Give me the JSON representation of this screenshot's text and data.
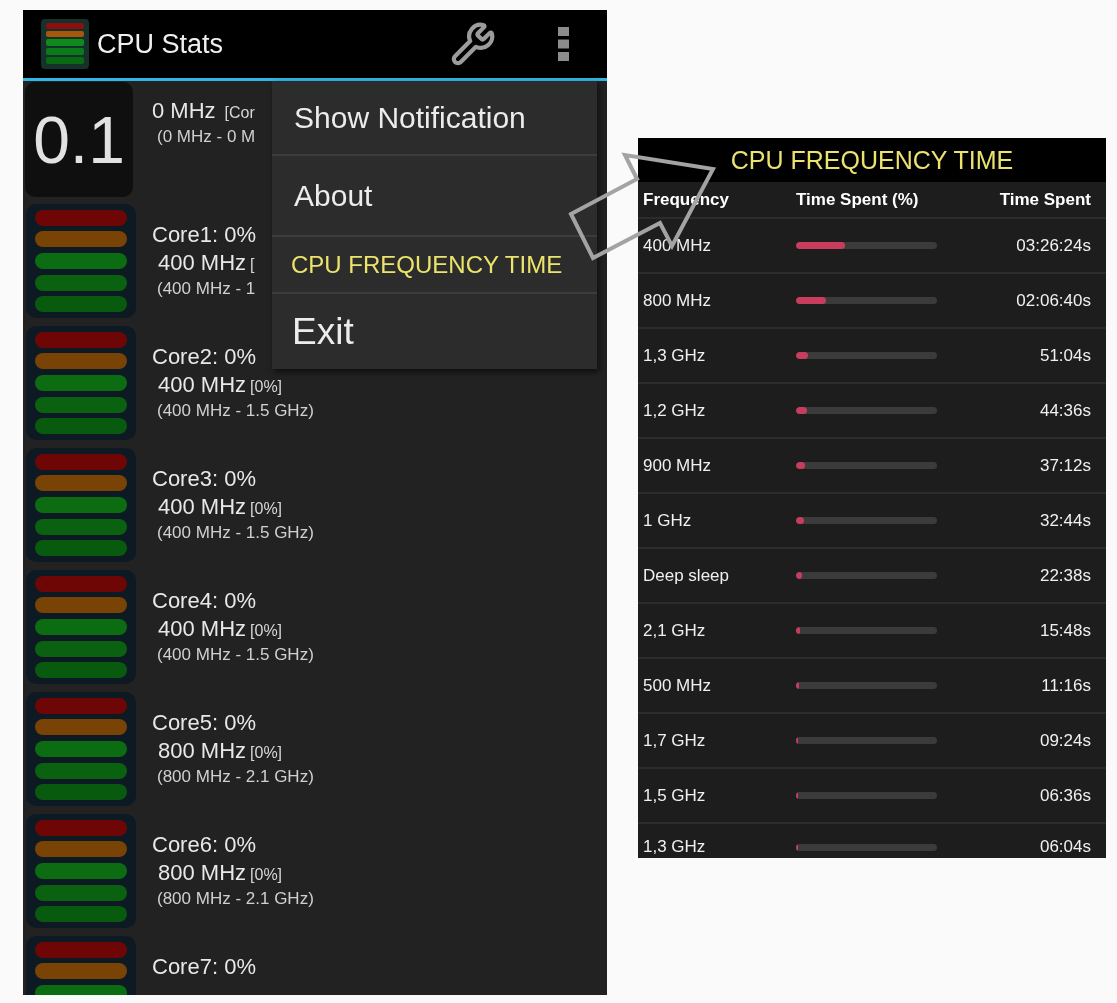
{
  "app_bar": {
    "title": "CPU Stats"
  },
  "cores": [
    {
      "kind": "total",
      "reading": "0.1",
      "frequency": "0 MHz",
      "usage": "[Cor",
      "range": "(0 MHz - 0 M"
    },
    {
      "kind": "core",
      "label": "Core1: 0%",
      "frequency": "400 MHz",
      "usage": "[",
      "range": "(400 MHz - 1"
    },
    {
      "kind": "core",
      "label": "Core2: 0%",
      "frequency": "400 MHz",
      "usage": "[0%]",
      "range": "(400 MHz - 1.5 GHz)"
    },
    {
      "kind": "core",
      "label": "Core3: 0%",
      "frequency": "400 MHz",
      "usage": "[0%]",
      "range": "(400 MHz - 1.5 GHz)"
    },
    {
      "kind": "core",
      "label": "Core4: 0%",
      "frequency": "400 MHz",
      "usage": "[0%]",
      "range": "(400 MHz - 1.5 GHz)"
    },
    {
      "kind": "core",
      "label": "Core5: 0%",
      "frequency": "800 MHz",
      "usage": "[0%]",
      "range": "(800 MHz - 2.1 GHz)"
    },
    {
      "kind": "core",
      "label": "Core6: 0%",
      "frequency": "800 MHz",
      "usage": "[0%]",
      "range": "(800 MHz - 2.1 GHz)"
    },
    {
      "kind": "core",
      "label": "Core7: 0%"
    }
  ],
  "overflow_menu": {
    "items": [
      {
        "label": "Show Notification",
        "selected": false
      },
      {
        "label": "About",
        "selected": false
      },
      {
        "label": "CPU FREQUENCY TIME",
        "selected": true
      },
      {
        "label": "Exit",
        "selected": false
      }
    ]
  },
  "frequency_panel": {
    "title": "CPU FREQUENCY TIME",
    "columns": [
      "Frequency",
      "Time Spent (%)",
      "Time Spent"
    ],
    "rows": [
      {
        "frequency": "400 MHz",
        "level": 0.35,
        "time": "03:26:24s"
      },
      {
        "frequency": "800 MHz",
        "level": 0.21,
        "time": "02:06:40s"
      },
      {
        "frequency": "1,3 GHz",
        "level": 0.085,
        "time": "51:04s"
      },
      {
        "frequency": "1,2 GHz",
        "level": 0.075,
        "time": "44:36s"
      },
      {
        "frequency": "900 MHz",
        "level": 0.065,
        "time": "37:12s"
      },
      {
        "frequency": "1 GHz",
        "level": 0.057,
        "time": "32:44s"
      },
      {
        "frequency": "Deep sleep",
        "level": 0.04,
        "time": "22:38s"
      },
      {
        "frequency": "2,1 GHz",
        "level": 0.028,
        "time": "15:48s"
      },
      {
        "frequency": "500 MHz",
        "level": 0.02,
        "time": "11:16s"
      },
      {
        "frequency": "1,7 GHz",
        "level": 0.016,
        "time": "09:24s"
      },
      {
        "frequency": "1,5 GHz",
        "level": 0.012,
        "time": "06:36s"
      },
      {
        "frequency": "1,3 GHz",
        "level": 0.011,
        "time": "06:04s"
      }
    ]
  }
}
